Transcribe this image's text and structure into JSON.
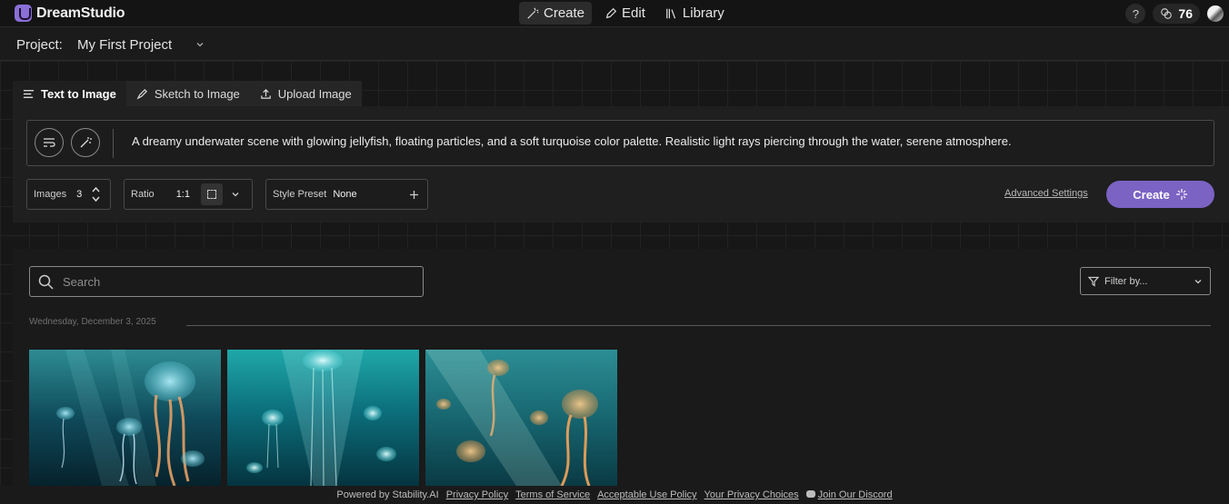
{
  "app": {
    "name": "DreamStudio"
  },
  "nav": {
    "items": [
      {
        "label": "Create",
        "icon": "magic-wand-icon",
        "active": true
      },
      {
        "label": "Edit",
        "icon": "pencil-icon",
        "active": false
      },
      {
        "label": "Library",
        "icon": "library-icon",
        "active": false
      }
    ]
  },
  "topright": {
    "help": "?",
    "credits": "76"
  },
  "project": {
    "label": "Project:",
    "name": "My First Project"
  },
  "tabs": [
    {
      "label": "Text to Image",
      "icon": "text-lines-icon",
      "active": true
    },
    {
      "label": "Sketch to Image",
      "icon": "brush-icon",
      "active": false
    },
    {
      "label": "Upload Image",
      "icon": "upload-icon",
      "active": false
    }
  ],
  "prompt": {
    "text": "A dreamy underwater scene with glowing jellyfish, floating particles, and a soft turquoise color palette. Realistic light rays piercing through the water, serene atmosphere."
  },
  "controls": {
    "images_label": "Images",
    "images_value": "3",
    "ratio_label": "Ratio",
    "ratio_value": "1:1",
    "style_label": "Style Preset",
    "style_value": "None",
    "advanced_settings": "Advanced Settings",
    "create_label": "Create"
  },
  "gallery": {
    "search_placeholder": "Search",
    "filter_placeholder": "Filter by...",
    "date_label": "Wednesday, December 3, 2025",
    "thumbnails": [
      {
        "alt": "jellyfish-1"
      },
      {
        "alt": "jellyfish-2"
      },
      {
        "alt": "jellyfish-3"
      }
    ]
  },
  "footer": {
    "powered_by": "Powered by Stability.AI",
    "links": [
      "Privacy Policy",
      "Terms of Service",
      "Acceptable Use Policy",
      "Your Privacy Choices",
      "Join Our Discord"
    ]
  },
  "colors": {
    "accent": "#7b63c4",
    "background": "#171717"
  }
}
